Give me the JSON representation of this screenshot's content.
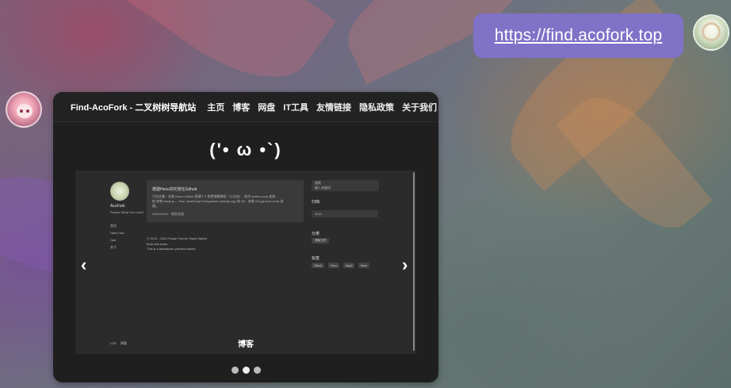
{
  "chat": {
    "user_message_link": "https://find.acofork.top",
    "user_avatar_icon": "avatar-icon",
    "bot_avatar_icon": "anime-avatar-icon"
  },
  "preview": {
    "site_title": "Find-AcoFork - 二叉树树导航站",
    "nav": [
      "主页",
      "博客",
      "网盘",
      "IT工具",
      "友情链接",
      "隐私政策",
      "关于我们"
    ],
    "kaomoji": "('• ω •`)",
    "carousel": {
      "slide_caption": "博客",
      "dots_count": 3,
      "active_dot_index": 1,
      "left_arrow": "‹",
      "right_arrow": "›",
      "screenshot": {
        "profile_name": "AcoFork",
        "profile_tagline": "Protect What You Love!",
        "side_links": [
          "首页",
          "Hello Hub",
          "Hub",
          "关于"
        ],
        "post_title": "搭建Hexo并托管在Github",
        "post_excerpt_1": "引用文章：关我 Hexo+Github 搭建个人免费博客教程（小白向）- 知乎 (zhihu.com) 安装",
        "post_excerpt_2": "前 安装 Node.js — Run JavaScript Everywhere (nodejs.org) 和 Git - 安装 Git (git-scm.com) 创",
        "post_excerpt_3": "建。",
        "post_meta": "2024-09-01 · 相关文档",
        "footer_line_1": "© 2020 - 2024 Fuwari Theme Stack Starter",
        "footer_line_2": "Built with Astro",
        "footer_line_3": "This is a Markdown preview theme",
        "search_label": "搜索",
        "search_placeholder": "输入关键词",
        "archive_label": "归档",
        "archive_value": "2024",
        "category_label": "分类",
        "category_tag": "博客文章",
        "tags_label": "标签",
        "tags": [
          "Github",
          "Hexo",
          "Jekyll",
          "Hertz"
        ],
        "footer_left_label": "UTA",
        "footer_left_value": "博客",
        "footer_caption": "博客"
      }
    }
  }
}
